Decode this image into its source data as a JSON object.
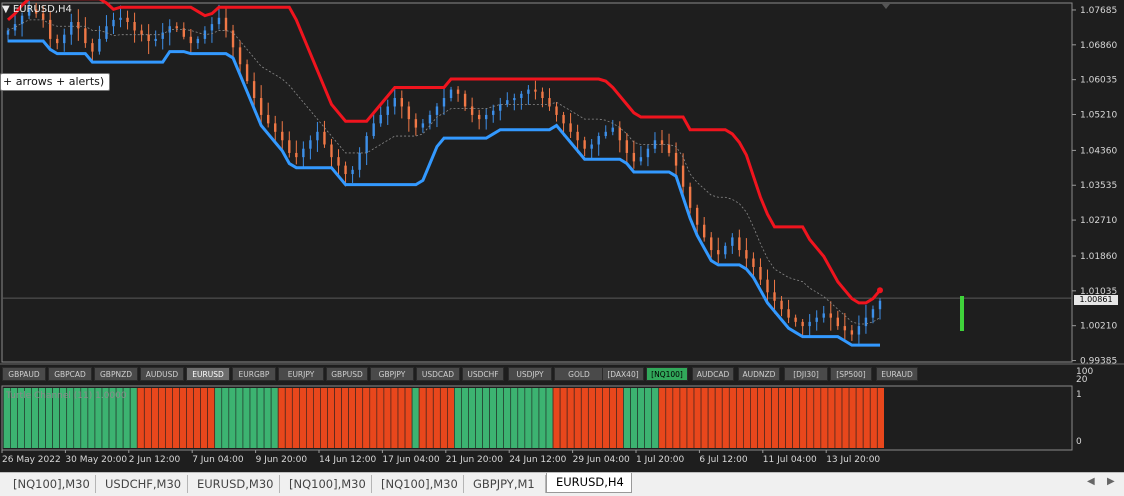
{
  "window": {
    "title": "EURUSD,H4"
  },
  "tooltip": {
    "text": "+ arrows + alerts)"
  },
  "indicator": {
    "label": "Turtle Channel (11) 1.0000",
    "scale_top": "1",
    "scale_bottom": "0",
    "top_extra": [
      "100",
      "20"
    ]
  },
  "price_axis": [
    "1.07685",
    "1.06860",
    "1.06035",
    "1.05210",
    "1.04360",
    "1.03535",
    "1.02710",
    "1.01860",
    "1.01035",
    "1.00210",
    "0.99385"
  ],
  "current_price": "1.00861",
  "time_axis": [
    "26 May 2022",
    "30 May 20:00",
    "2 Jun 12:00",
    "7 Jun 04:00",
    "9 Jun 20:00",
    "14 Jun 12:00",
    "17 Jun 04:00",
    "21 Jun 20:00",
    "24 Jun 12:00",
    "29 Jun 04:00",
    "1 Jul 20:00",
    "6 Jul 12:00",
    "11 Jul 04:00",
    "13 Jul 20:00"
  ],
  "symbols": [
    {
      "label": "GBPAUD",
      "state": "normal"
    },
    {
      "label": "GBPCAD",
      "state": "normal"
    },
    {
      "label": "GBPNZD",
      "state": "normal"
    },
    {
      "label": "AUDUSD",
      "state": "normal"
    },
    {
      "label": "EURUSD",
      "state": "active"
    },
    {
      "label": "EURGBP",
      "state": "normal"
    },
    {
      "label": "EURJPY",
      "state": "normal"
    },
    {
      "label": "GBPUSD",
      "state": "normal"
    },
    {
      "label": "GBPJPY",
      "state": "normal"
    },
    {
      "label": "USDCAD",
      "state": "normal"
    },
    {
      "label": "USDCHF",
      "state": "normal"
    },
    {
      "label": "USDJPY",
      "state": "normal"
    },
    {
      "label": "GOLD",
      "state": "normal"
    },
    {
      "label": "[DAX40]",
      "state": "normal"
    },
    {
      "label": "[NQ100]",
      "state": "green"
    },
    {
      "label": "AUDCAD",
      "state": "normal"
    },
    {
      "label": "AUDNZD",
      "state": "normal"
    },
    {
      "label": "[DJI30]",
      "state": "normal"
    },
    {
      "label": "[SP500]",
      "state": "normal"
    },
    {
      "label": "EURAUD",
      "state": "normal"
    }
  ],
  "tabs": [
    {
      "label": "[NQ100],M30",
      "active": false
    },
    {
      "label": "USDCHF,M30",
      "active": false
    },
    {
      "label": "EURUSD,M30",
      "active": false
    },
    {
      "label": "[NQ100],M30",
      "active": false
    },
    {
      "label": "[NQ100],M30",
      "active": false
    },
    {
      "label": "GBPJPY,M1",
      "active": false
    },
    {
      "label": "EURUSD,H4",
      "active": true
    }
  ],
  "colors": {
    "bull": "#3d8fe8",
    "bear": "#f07846",
    "upper": "#f0141e",
    "lower": "#3399ff",
    "hist_up": "#3cb371",
    "hist_down": "#e8471c",
    "bg": "#1e1e1e",
    "grid": "#3a3a3a"
  },
  "chart_data": {
    "type": "candlestick",
    "symbol": "EURUSD",
    "timeframe": "H4",
    "ylim": [
      0.9935,
      1.0785
    ],
    "close_series": [
      1.072,
      1.0735,
      1.0755,
      1.077,
      1.076,
      1.0745,
      1.07,
      1.069,
      1.071,
      1.074,
      1.0725,
      1.069,
      1.067,
      1.07,
      1.073,
      1.0745,
      1.075,
      1.074,
      1.072,
      1.071,
      1.0695,
      1.07,
      1.0715,
      1.073,
      1.0725,
      1.0705,
      1.069,
      1.07,
      1.072,
      1.0735,
      1.075,
      1.072,
      1.068,
      1.064,
      1.06,
      1.056,
      1.052,
      1.05,
      1.048,
      1.046,
      1.043,
      1.042,
      1.044,
      1.046,
      1.048,
      1.045,
      1.042,
      1.04,
      1.038,
      1.039,
      1.043,
      1.047,
      1.05,
      1.052,
      1.054,
      1.056,
      1.054,
      1.051,
      1.049,
      1.05,
      1.052,
      1.054,
      1.056,
      1.058,
      1.057,
      1.054,
      1.052,
      1.051,
      1.052,
      1.053,
      1.0545,
      1.0555,
      1.056,
      1.057,
      1.058,
      1.0575,
      1.056,
      1.054,
      1.052,
      1.05,
      1.048,
      1.046,
      1.044,
      1.045,
      1.047,
      1.048,
      1.049,
      1.046,
      1.043,
      1.041,
      1.042,
      1.044,
      1.046,
      1.045,
      1.043,
      1.04,
      1.035,
      1.03,
      1.026,
      1.023,
      1.02,
      1.019,
      1.021,
      1.023,
      1.02,
      1.018,
      1.016,
      1.013,
      1.01,
      1.008,
      1.006,
      1.004,
      1.003,
      1.002,
      1.003,
      1.004,
      1.005,
      1.004,
      1.002,
      1.001,
      1.0,
      1.002,
      1.004,
      1.006,
      1.008
    ],
    "turtle_channel_signal": [
      1,
      1,
      1,
      1,
      1,
      1,
      1,
      1,
      1,
      1,
      1,
      1,
      1,
      1,
      1,
      1,
      1,
      1,
      1,
      0,
      0,
      0,
      0,
      0,
      0,
      0,
      0,
      0,
      0,
      0,
      1,
      1,
      1,
      1,
      1,
      1,
      1,
      1,
      1,
      0,
      0,
      0,
      0,
      0,
      0,
      0,
      0,
      0,
      0,
      0,
      0,
      0,
      0,
      0,
      0,
      0,
      0,
      0,
      1,
      0,
      0,
      0,
      0,
      0,
      1,
      1,
      1,
      1,
      1,
      1,
      1,
      1,
      1,
      1,
      1,
      1,
      1,
      1,
      0,
      0,
      0,
      0,
      0,
      0,
      0,
      0,
      0,
      0,
      1,
      1,
      1,
      1,
      1,
      0,
      0,
      0,
      0,
      0,
      0,
      0,
      0,
      0,
      0,
      0,
      0,
      0,
      0,
      0,
      0,
      0,
      0,
      0,
      0,
      0,
      0,
      0,
      0,
      0,
      0,
      0,
      0,
      0,
      0,
      0,
      0
    ]
  }
}
